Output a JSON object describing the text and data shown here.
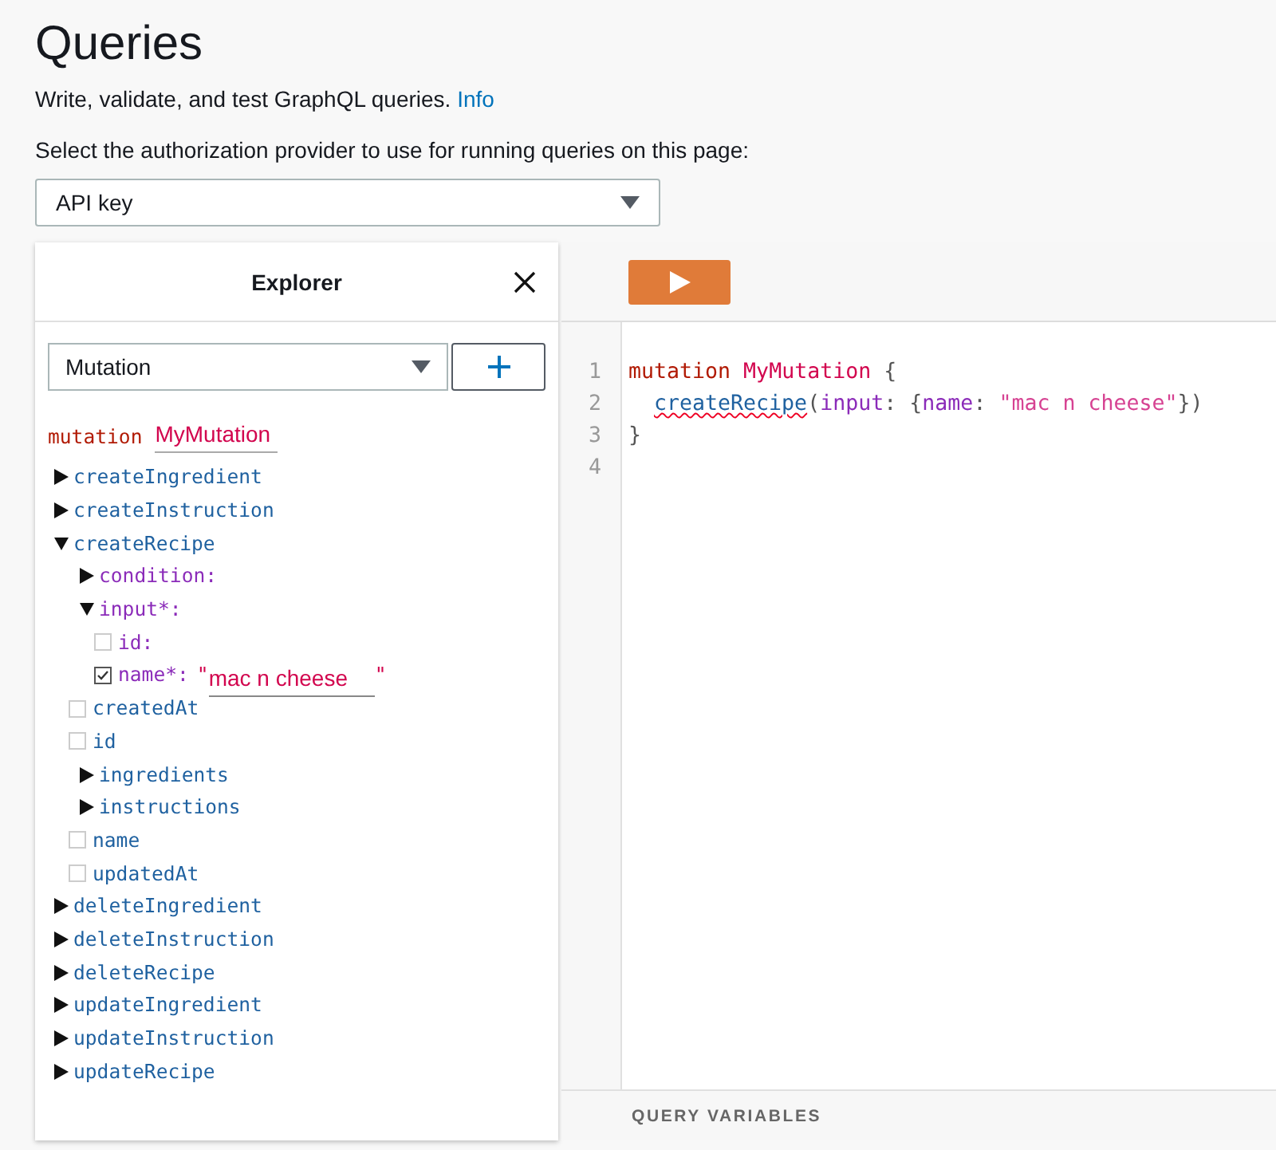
{
  "page": {
    "title": "Queries",
    "description": "Write, validate, and test GraphQL queries.",
    "info_link": "Info",
    "auth_label": "Select the authorization provider to use for running queries on this page:",
    "auth_provider": "API key"
  },
  "explorer": {
    "title": "Explorer",
    "operation_type": "Mutation",
    "operation_keyword": "mutation",
    "operation_name": "MyMutation",
    "tree": [
      {
        "label": "createIngredient",
        "kind": "field",
        "expanded": false
      },
      {
        "label": "createInstruction",
        "kind": "field",
        "expanded": false
      },
      {
        "label": "createRecipe",
        "kind": "field",
        "expanded": true,
        "children": [
          {
            "label": "condition:",
            "kind": "arg",
            "expanded": false
          },
          {
            "label": "input*:",
            "kind": "arg",
            "expanded": true,
            "children": [
              {
                "label": "id:",
                "kind": "arg-leaf",
                "checked": false
              },
              {
                "label": "name*:",
                "kind": "arg-leaf",
                "checked": true,
                "quote_open": "\"",
                "value": "mac n cheese",
                "quote_close": "\""
              }
            ]
          },
          {
            "label": "createdAt",
            "kind": "leaf",
            "checked": false
          },
          {
            "label": "id",
            "kind": "leaf",
            "checked": false
          },
          {
            "label": "ingredients",
            "kind": "field",
            "expanded": false
          },
          {
            "label": "instructions",
            "kind": "field",
            "expanded": false
          },
          {
            "label": "name",
            "kind": "leaf",
            "checked": false
          },
          {
            "label": "updatedAt",
            "kind": "leaf",
            "checked": false
          }
        ]
      },
      {
        "label": "deleteIngredient",
        "kind": "field",
        "expanded": false
      },
      {
        "label": "deleteInstruction",
        "kind": "field",
        "expanded": false
      },
      {
        "label": "deleteRecipe",
        "kind": "field",
        "expanded": false
      },
      {
        "label": "updateIngredient",
        "kind": "field",
        "expanded": false
      },
      {
        "label": "updateInstruction",
        "kind": "field",
        "expanded": false
      },
      {
        "label": "updateRecipe",
        "kind": "field",
        "expanded": false
      }
    ]
  },
  "editor": {
    "lines": [
      {
        "number": "1",
        "indented": false,
        "tokens": [
          {
            "text": "mutation",
            "kind": "keyword"
          },
          {
            "text": " MyMutation",
            "kind": "def"
          },
          {
            "text": " {",
            "kind": "plain"
          }
        ]
      },
      {
        "number": "2",
        "indented": true,
        "tokens": [
          {
            "text": "createRecipe",
            "kind": "error-field"
          },
          {
            "text": "(",
            "kind": "plain"
          },
          {
            "text": "input",
            "kind": "attr"
          },
          {
            "text": ": {",
            "kind": "plain"
          },
          {
            "text": "name",
            "kind": "attr"
          },
          {
            "text": ": ",
            "kind": "plain"
          },
          {
            "text": "\"mac n cheese\"",
            "kind": "string"
          },
          {
            "text": "})",
            "kind": "plain"
          }
        ]
      },
      {
        "number": "3",
        "indented": false,
        "tokens": [
          {
            "text": "}",
            "kind": "plain"
          }
        ]
      },
      {
        "number": "4"
      }
    ],
    "variables_label": "QUERY VARIABLES"
  }
}
